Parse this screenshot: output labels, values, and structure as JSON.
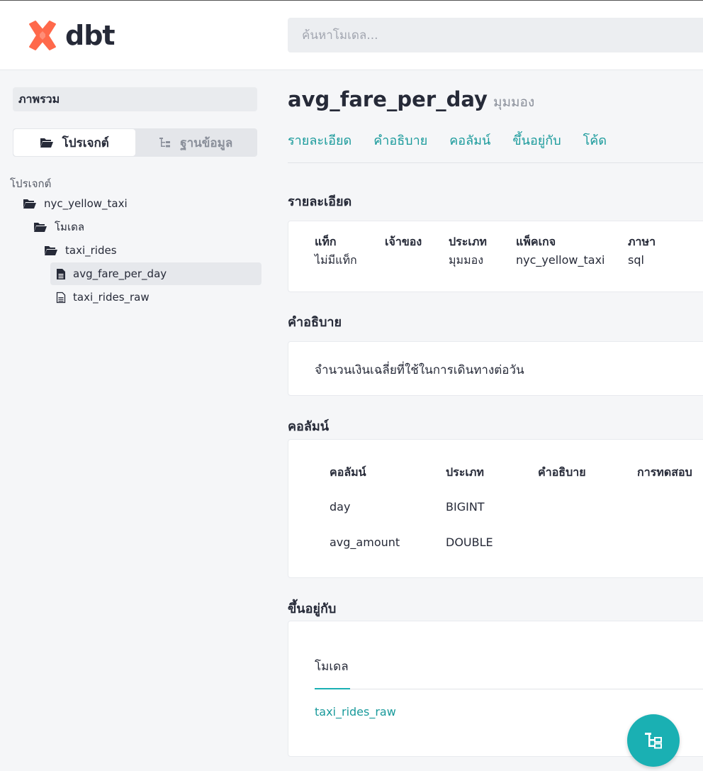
{
  "header": {
    "logo_text": "dbt",
    "search_placeholder": "ค้นหาโมเดล...",
    "brand_color": "#ff694b"
  },
  "sidebar": {
    "overview_label": "ภาพรวม",
    "toggle": {
      "project_label": "โปรเจกต์",
      "database_label": "ฐานข้อมูล"
    },
    "tree_title": "โปรเจกต์",
    "tree": [
      {
        "label": "nyc_yellow_taxi",
        "icon": "folder-open-icon"
      },
      {
        "label": "โมเดล",
        "icon": "folder-open-icon"
      },
      {
        "label": "taxi_rides",
        "icon": "folder-open-icon"
      },
      {
        "label": "avg_fare_per_day",
        "icon": "document-icon",
        "selected": true
      },
      {
        "label": "taxi_rides_raw",
        "icon": "document-outline-icon"
      }
    ]
  },
  "main": {
    "model_name": "avg_fare_per_day",
    "model_type": "มุมมอง",
    "tabs": [
      "รายละเอียด",
      "คำอธิบาย",
      "คอลัมน์",
      "ขึ้นอยู่กับ",
      "โค้ด"
    ],
    "details": {
      "title": "รายละเอียด",
      "items": [
        {
          "label": "แท็ก",
          "value": "ไม่มีแท็ก"
        },
        {
          "label": "เจ้าของ",
          "value": ""
        },
        {
          "label": "ประเภท",
          "value": "มุมมอง"
        },
        {
          "label": "แพ็คเกจ",
          "value": "nyc_yellow_taxi"
        },
        {
          "label": "ภาษา",
          "value": "sql"
        }
      ]
    },
    "description": {
      "title": "คำอธิบาย",
      "text": "จำนวนเงินเฉลี่ยที่ใช้ในการเดินทางต่อวัน"
    },
    "columns": {
      "title": "คอลัมน์",
      "headers": [
        "คอลัมน์",
        "ประเภท",
        "คำอธิบาย",
        "การทดสอบ"
      ],
      "rows": [
        {
          "name": "day",
          "type": "BIGINT"
        },
        {
          "name": "avg_amount",
          "type": "DOUBLE"
        }
      ]
    },
    "depends_on": {
      "title": "ขึ้นอยู่กับ",
      "tab_label": "โมเดล",
      "link": "taxi_rides_raw"
    }
  },
  "accent_color": "#1ab0b3",
  "fab_icon": "lineage-graph-icon"
}
